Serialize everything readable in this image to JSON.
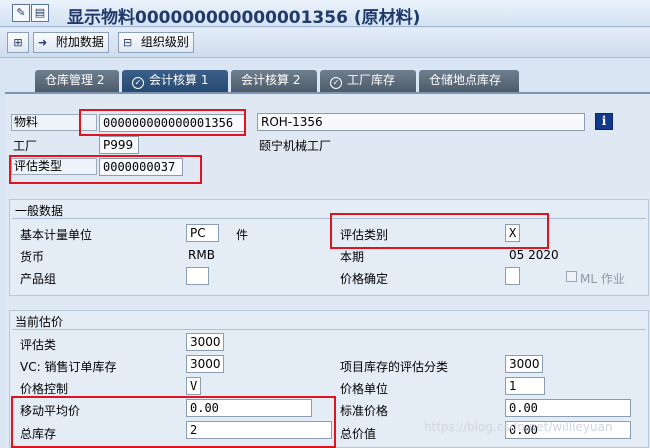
{
  "window": {
    "title": "显示物料000000000000001356 (原材料)"
  },
  "toolbar": {
    "add_data_label": "附加数据",
    "org_levels_label": "组织级别"
  },
  "tabs": [
    {
      "label": "仓库管理 2"
    },
    {
      "label": "会计核算 1",
      "active": true
    },
    {
      "label": "会计核算 2"
    },
    {
      "label": "工厂库存"
    },
    {
      "label": "仓储地点库存"
    }
  ],
  "header": {
    "material_label": "物料",
    "material_value": "000000000000001356",
    "material_desc": "ROH-1356",
    "plant_label": "工厂",
    "plant_value": "P999",
    "plant_name": "颐宁机械工厂",
    "val_type_label": "评估类型",
    "val_type_value": "0000000037"
  },
  "general": {
    "title": "一般数据",
    "base_uom_label": "基本计量单位",
    "base_uom_value": "PC",
    "base_uom_text": "件",
    "val_category_label": "评估类别",
    "val_category_value": "X",
    "currency_label": "货币",
    "currency_value": "RMB",
    "period_label": "本期",
    "period_value": "05 2020",
    "division_label": "产品组",
    "division_value": "",
    "price_det_label": "价格确定",
    "price_det_value": "",
    "ml_act_label": "ML 作业"
  },
  "current": {
    "title": "当前估价",
    "val_class_label": "评估类",
    "val_class_value": "3000",
    "vc_label": "VC: 销售订单库存",
    "vc_value": "3000",
    "proj_label": "项目库存的评估分类",
    "proj_value": "3000",
    "price_ctrl_label": "价格控制",
    "price_ctrl_value": "V",
    "price_unit_label": "价格单位",
    "price_unit_value": "1",
    "map_label": "移动平均价",
    "map_value": "0.00",
    "std_price_label": "标准价格",
    "std_price_value": "0.00",
    "total_stock_label": "总库存",
    "total_stock_value": "2",
    "total_value_label": "总价值",
    "total_value_value": "0.00"
  },
  "watermark": "https://blog.csdn.net/willieyuan",
  "colors": {
    "highlight": "#e0141e",
    "tab_active": "#274a72",
    "title": "#1f3a6b"
  }
}
